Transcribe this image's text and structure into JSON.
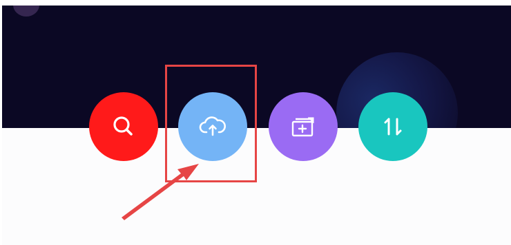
{
  "buttons": [
    {
      "id": "search",
      "icon": "search-icon",
      "color": "#ff1a1a"
    },
    {
      "id": "upload",
      "icon": "cloud-upload-icon",
      "color": "#74b4f6"
    },
    {
      "id": "add",
      "icon": "add-folder-icon",
      "color": "#9a6bf3"
    },
    {
      "id": "sort",
      "icon": "sort-icon",
      "color": "#19c6bf"
    }
  ],
  "annotation": {
    "highlight_color": "#e64545",
    "highlighted_button": "upload"
  },
  "background": {
    "top_color": "#0b0824",
    "bottom_color": "#fcfcfd"
  }
}
